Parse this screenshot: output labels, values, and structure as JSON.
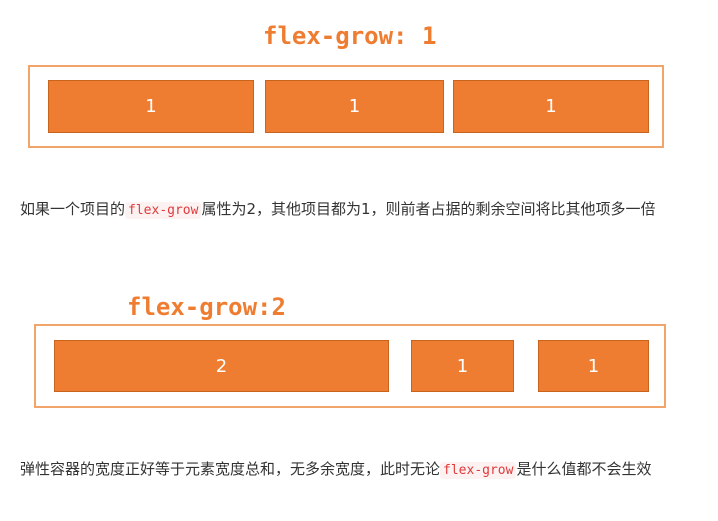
{
  "figure1": {
    "title": "flex-grow: 1",
    "items": [
      "1",
      "1",
      "1"
    ]
  },
  "paragraph1": {
    "before": "如果一个项目的",
    "code": "flex-grow",
    "after": "属性为2，其他项目都为1，则前者占据的剩余空间将比其他项多一倍"
  },
  "figure2": {
    "title": "flex-grow:2",
    "items": [
      "2",
      "1",
      "1"
    ]
  },
  "paragraph2": {
    "before": "弹性容器的宽度正好等于元素宽度总和，无多余宽度，此时无论",
    "code": "flex-grow",
    "after": "是什么值都不会生效"
  },
  "colors": {
    "accent": "#ef7d31",
    "border": "#f1a56a",
    "code_text": "#e03a3a"
  }
}
